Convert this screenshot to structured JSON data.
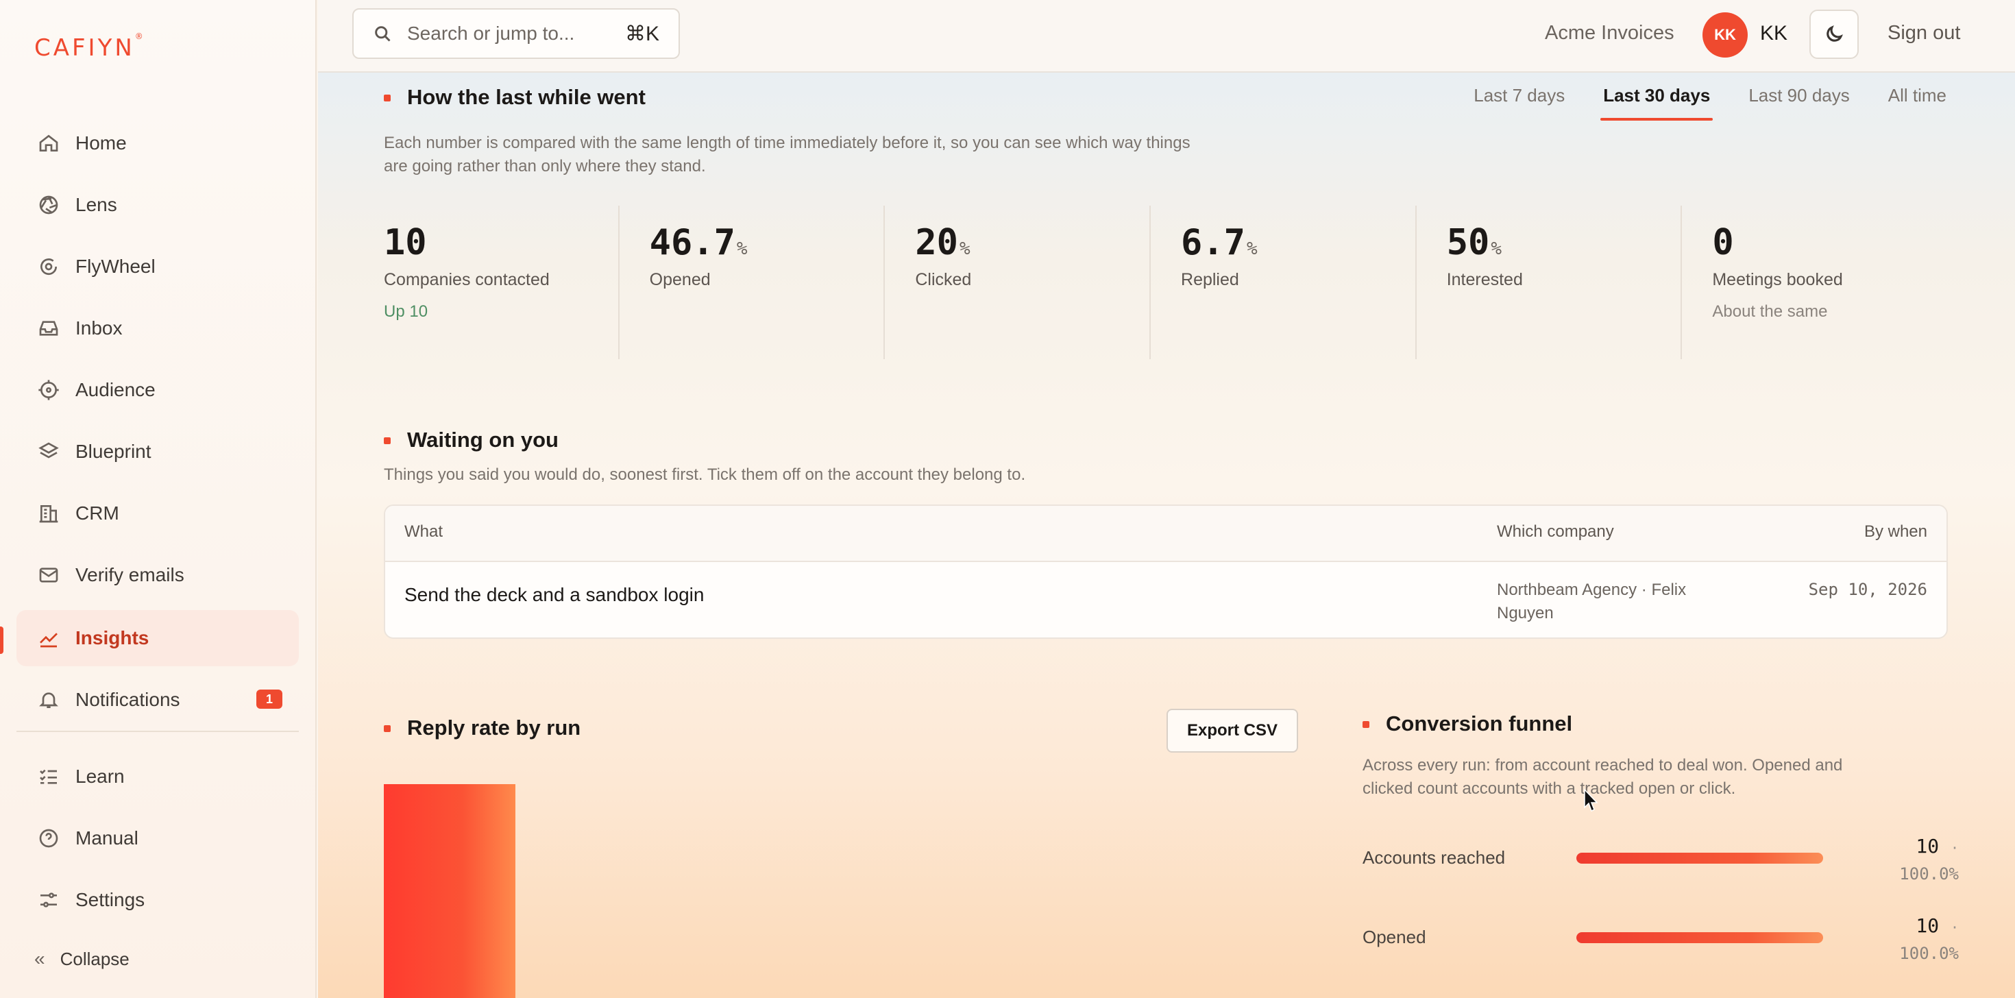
{
  "app": {
    "logo": "CAFIYN",
    "logo_mark": "®"
  },
  "sidebar": {
    "items": [
      {
        "label": "Home",
        "icon": "home-icon"
      },
      {
        "label": "Lens",
        "icon": "aperture-icon"
      },
      {
        "label": "FlyWheel",
        "icon": "flywheel-icon"
      },
      {
        "label": "Inbox",
        "icon": "inbox-icon"
      },
      {
        "label": "Audience",
        "icon": "target-icon"
      },
      {
        "label": "Blueprint",
        "icon": "layers-icon"
      },
      {
        "label": "CRM",
        "icon": "building-icon"
      },
      {
        "label": "Verify emails",
        "icon": "mail-icon"
      },
      {
        "label": "Insights",
        "icon": "trend-chart-icon",
        "active": true
      },
      {
        "label": "Notifications",
        "icon": "bell-icon",
        "badge": "1"
      },
      {
        "label": "Learn",
        "icon": "list-check-icon"
      },
      {
        "label": "Manual",
        "icon": "help-circle-icon"
      },
      {
        "label": "Settings",
        "icon": "sliders-icon"
      }
    ],
    "collapse_label": "Collapse"
  },
  "topbar": {
    "search_placeholder": "Search or jump to...",
    "search_shortcut": "⌘K",
    "account_name": "Acme Invoices",
    "avatar_initials": "KK",
    "user_initials": "KK",
    "sign_out": "Sign out"
  },
  "summary": {
    "title": "How the last while went",
    "description_line1": "Each number is compared with the same length of time immediately before it, so you can see which way things",
    "description_line2": "are going rather than only where they stand.",
    "ranges": [
      "Last 7 days",
      "Last 30 days",
      "Last 90 days",
      "All time"
    ],
    "selected_range": "Last 30 days",
    "stats": [
      {
        "value": "10",
        "unit": "",
        "label": "Companies contacted",
        "change": "Up 10"
      },
      {
        "value": "46.7",
        "unit": "%",
        "label": "Opened",
        "change": ""
      },
      {
        "value": "20",
        "unit": "%",
        "label": "Clicked",
        "change": ""
      },
      {
        "value": "6.7",
        "unit": "%",
        "label": "Replied",
        "change": ""
      },
      {
        "value": "50",
        "unit": "%",
        "label": "Interested",
        "change": ""
      },
      {
        "value": "0",
        "unit": "",
        "label": "Meetings booked",
        "change": "About the same"
      }
    ]
  },
  "waiting": {
    "title": "Waiting on you",
    "description": "Things you said you would do, soonest first. Tick them off on the account they belong to.",
    "columns": {
      "what": "What",
      "company": "Which company",
      "when": "By when"
    },
    "rows": [
      {
        "what": "Send the deck and a sandbox login",
        "company_line1": "Northbeam Agency · Felix",
        "company_line2": "Nguyen",
        "when": "Sep 10, 2026"
      }
    ]
  },
  "reply_rate": {
    "title": "Reply rate by run",
    "export_label": "Export CSV"
  },
  "funnel": {
    "title": "Conversion funnel",
    "description_line1": "Across every run: from account reached to deal won. Opened and",
    "description_line2": "clicked count accounts with a tracked open or click.",
    "rows": [
      {
        "label": "Accounts reached",
        "count": "10",
        "percent": "100.0%",
        "fraction": 1.0
      },
      {
        "label": "Opened",
        "count": "10",
        "percent": "100.0%",
        "fraction": 1.0
      }
    ]
  },
  "colors": {
    "accent": "#ef4a2f",
    "positive": "#4f8f64"
  }
}
